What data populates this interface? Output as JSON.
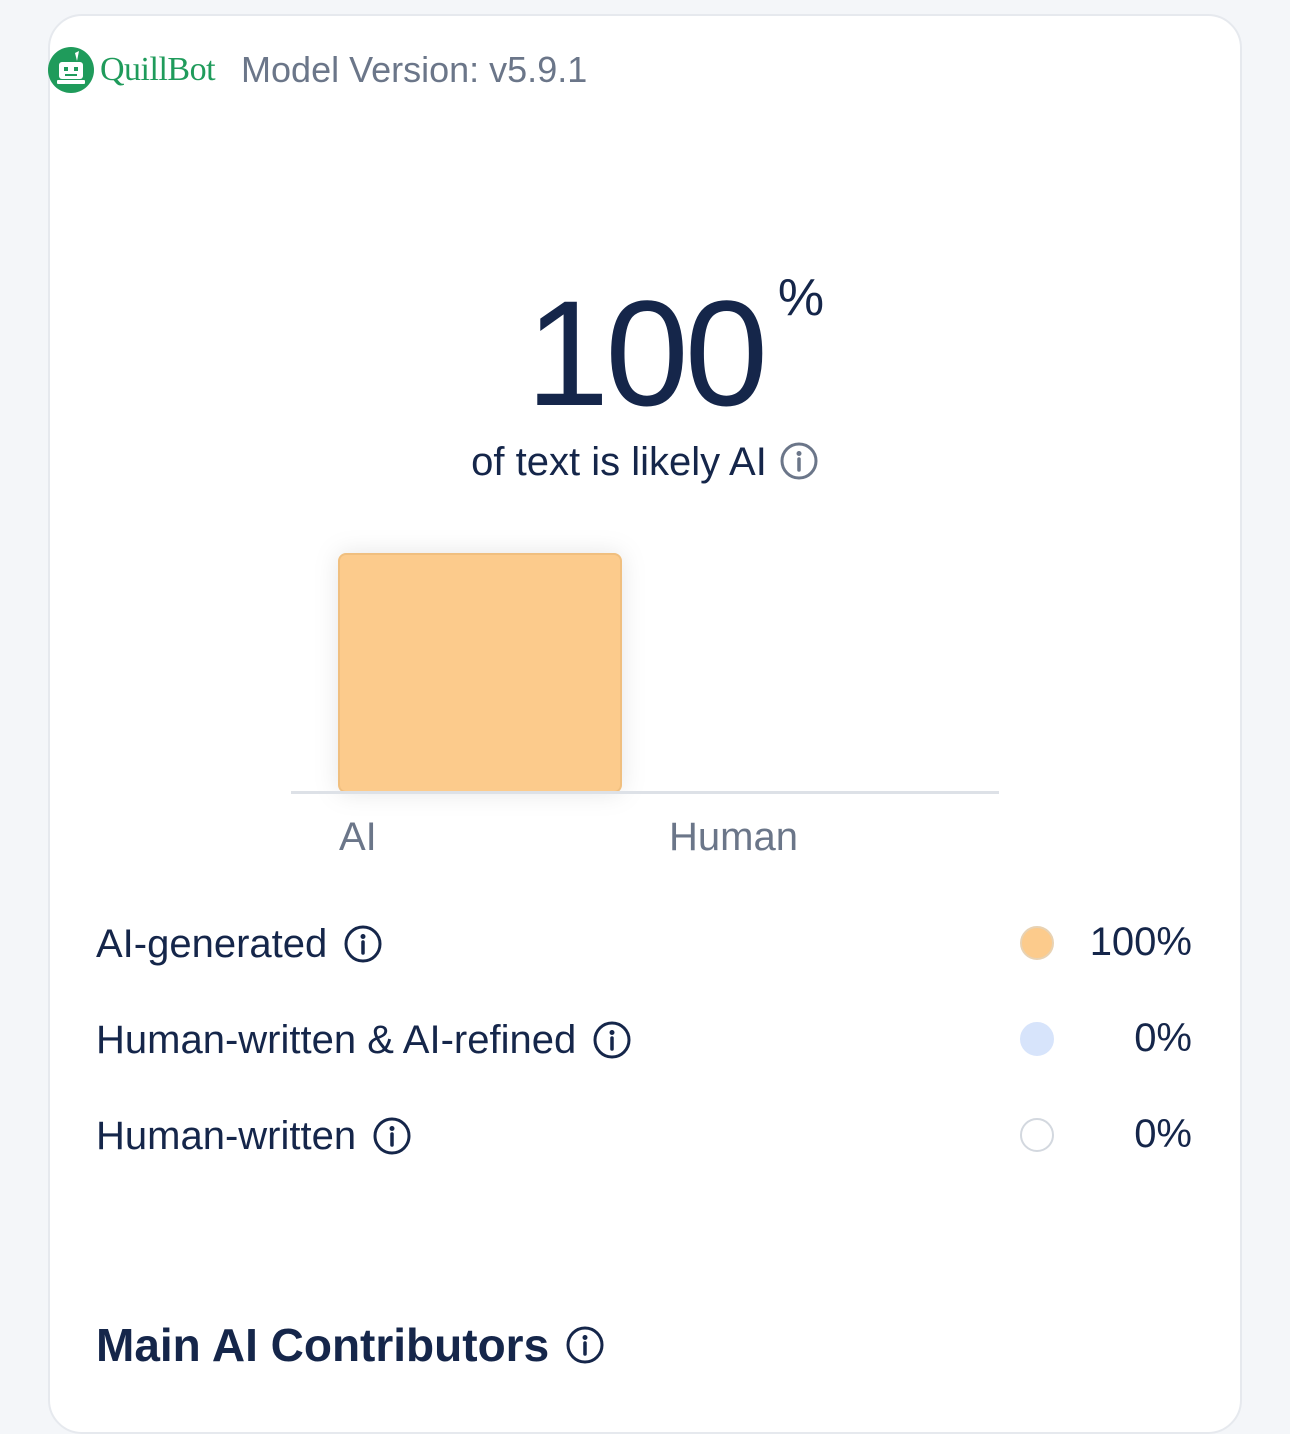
{
  "header": {
    "brand": "QuillBot",
    "model_version": "Model Version: v5.9.1"
  },
  "score": {
    "value": "100",
    "unit": "%",
    "caption": "of text is likely AI"
  },
  "chart_data": {
    "type": "bar",
    "categories": [
      "AI",
      "Human"
    ],
    "values": [
      100,
      0
    ],
    "ylim": [
      0,
      100
    ],
    "colors": [
      "#fccb8c",
      "#d7e4fb"
    ],
    "title": "",
    "xlabel": "",
    "ylabel": ""
  },
  "breakdown": [
    {
      "label": "AI-generated",
      "value": "100%",
      "color": "#fccb8c",
      "border": "#e8d2b3"
    },
    {
      "label": "Human-written & AI-refined",
      "value": "0%",
      "color": "#d7e4fb",
      "border": "#d7e4fb"
    },
    {
      "label": "Human-written",
      "value": "0%",
      "color": "#ffffff",
      "border": "#d3d8df"
    }
  ],
  "contributors": {
    "title": "Main AI Contributors"
  },
  "icons": {
    "brand": "quillbot-logo-icon",
    "info": "info-icon"
  }
}
